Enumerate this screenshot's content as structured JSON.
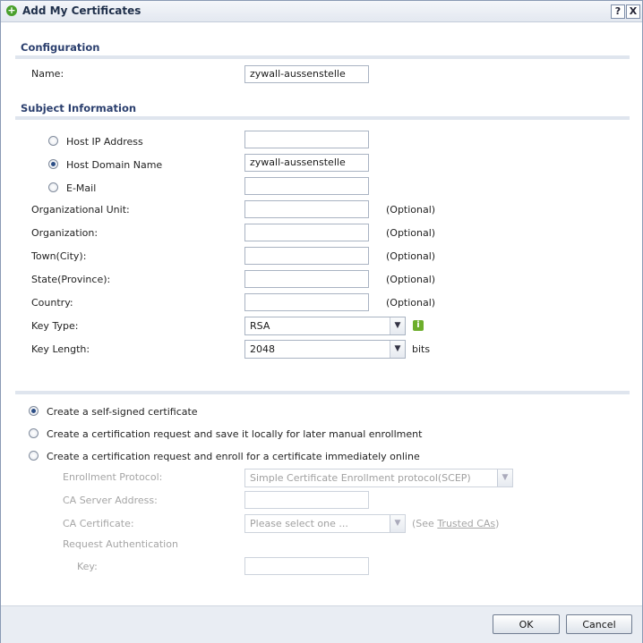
{
  "window": {
    "title": "Add My Certificates",
    "help_label": "?",
    "close_label": "X"
  },
  "configuration": {
    "heading": "Configuration",
    "name_label": "Name:",
    "name_value": "zywall-aussenstelle"
  },
  "subject": {
    "heading": "Subject Information",
    "host_ip_label": "Host IP Address",
    "host_ip_value": "",
    "host_domain_label": "Host Domain Name",
    "host_domain_value": "zywall-aussenstelle",
    "email_label": "E-Mail",
    "email_value": "",
    "selected_identity": "host_domain",
    "org_unit_label": "Organizational Unit:",
    "organization_label": "Organization:",
    "town_label": "Town(City):",
    "state_label": "State(Province):",
    "country_label": "Country:",
    "optional_text": "(Optional)",
    "key_type_label": "Key Type:",
    "key_type_value": "RSA",
    "key_length_label": "Key Length:",
    "key_length_value": "2048",
    "bits_text": "bits"
  },
  "options": {
    "self_signed_label": "Create a self-signed certificate",
    "request_local_label": "Create a certification request and save it locally for later manual enrollment",
    "request_online_label": "Create a certification request and enroll for a certificate immediately online",
    "selected": "self_signed"
  },
  "enrollment": {
    "protocol_label": "Enrollment Protocol:",
    "protocol_value": "Simple Certificate Enrollment protocol(SCEP)",
    "ca_server_label": "CA Server Address:",
    "ca_server_value": "",
    "ca_cert_label": "CA Certificate:",
    "ca_cert_placeholder": "Please select one ...",
    "see_prefix": "(See ",
    "trusted_cas_link": "Trusted CAs",
    "see_suffix": ")",
    "request_auth_label": "Request Authentication",
    "key_label": "Key:",
    "key_value": ""
  },
  "footer": {
    "ok_label": "OK",
    "cancel_label": "Cancel"
  }
}
